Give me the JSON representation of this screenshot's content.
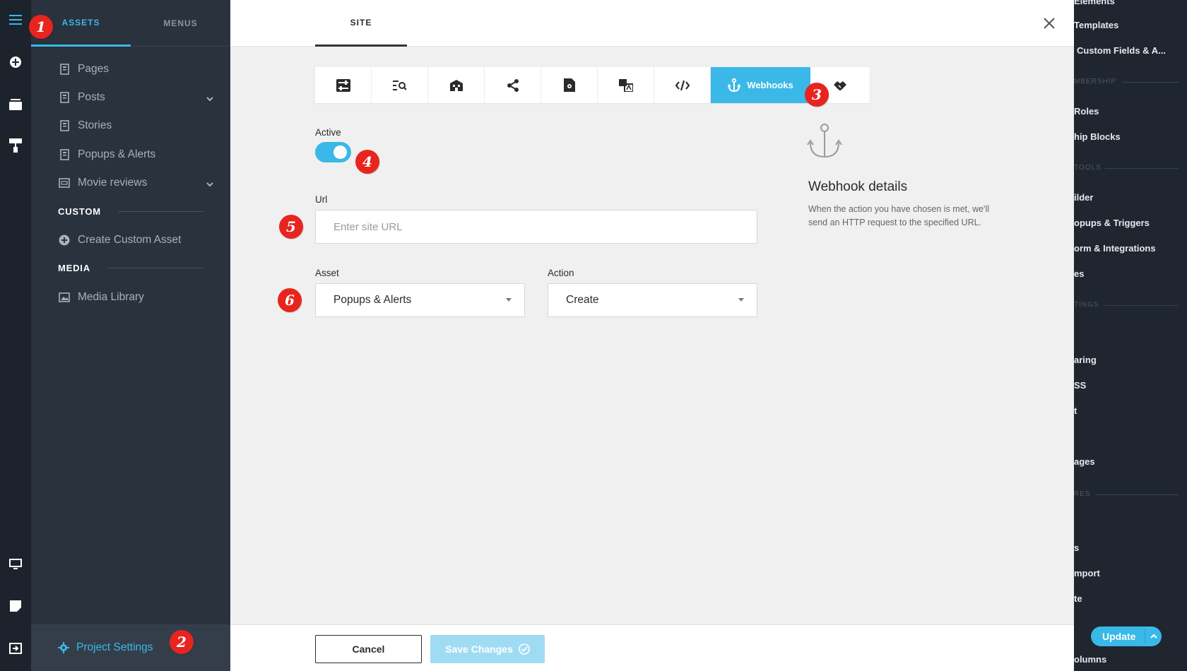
{
  "sidebar": {
    "tabs": {
      "assets": "ASSETS",
      "menus": "MENUS"
    },
    "items": [
      {
        "label": "Pages",
        "icon": "page-icon"
      },
      {
        "label": "Posts",
        "icon": "page-icon",
        "expandable": true
      },
      {
        "label": "Stories",
        "icon": "page-icon"
      },
      {
        "label": "Popups & Alerts",
        "icon": "page-icon"
      },
      {
        "label": "Movie reviews",
        "icon": "ticket-icon",
        "expandable": true
      }
    ],
    "custom_section": "CUSTOM",
    "create_custom": "Create Custom Asset",
    "media_section": "MEDIA",
    "media_library": "Media Library",
    "project_settings": "Project Settings"
  },
  "right_panel": {
    "items": [
      "Elements",
      "Templates",
      "Custom Fields & A...",
      "Roles",
      "hip Blocks",
      "ilder",
      "opups & Triggers",
      "orm & Integrations",
      "es",
      "aring",
      "SS",
      "t",
      "ages",
      "s",
      "mport",
      "te",
      "olumns"
    ],
    "sections": [
      "MBERSHIP",
      "TOOLS",
      "TINGS",
      "RES"
    ],
    "update_label": "Update"
  },
  "modal": {
    "tab": "SITE",
    "active_tab_label": "Webhooks",
    "active_label": "Active",
    "active_toggle_on": true,
    "url_label": "Url",
    "url_placeholder": "Enter site URL",
    "url_value": "",
    "asset_label": "Asset",
    "asset_value": "Popups & Alerts",
    "action_label": "Action",
    "action_value": "Create",
    "details_title": "Webhook details",
    "details_text": "When the action you have chosen is met, we'll send an HTTP request to the specified URL.",
    "cancel_label": "Cancel",
    "save_label": "Save Changes"
  },
  "markers": [
    "1",
    "2",
    "3",
    "4",
    "5",
    "6"
  ],
  "colors": {
    "accent": "#3ab8e8",
    "marker": "#e8241f",
    "sidebar_bg": "#2a323d",
    "rail_bg": "#1c232c"
  }
}
